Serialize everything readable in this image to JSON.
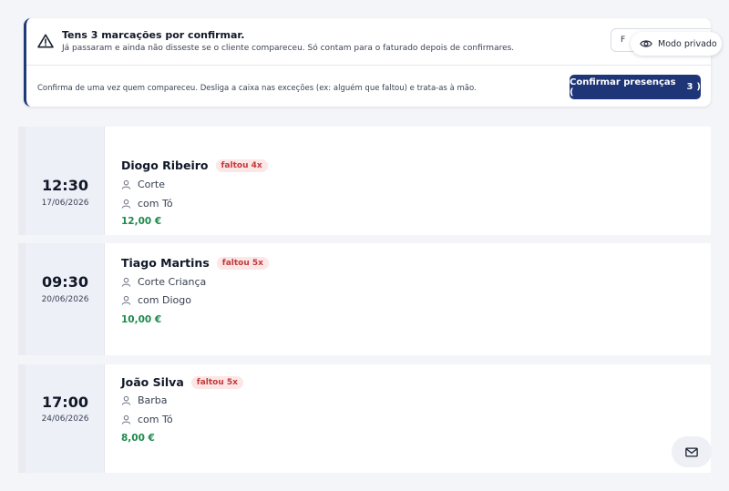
{
  "alert": {
    "title": "Tens 3 marcações por confirmar.",
    "description": "Já passaram e ainda não disseste se o cliente compareceu. Só contam para o faturado depois de confirmares.",
    "stub_label": "F",
    "hint": "Confirma de uma vez quem compareceu. Desliga a caixa nas exceções (ex: alguém que faltou) e trata-as à mão.",
    "confirm_label": "Confirmar presenças (",
    "confirm_count": "3",
    "confirm_close": ")",
    "icon": "warning-icon"
  },
  "private_mode": {
    "label": "Modo privado",
    "icon": "eye-icon"
  },
  "appointments": [
    {
      "time": "12:30",
      "date": "17/06/2026",
      "client": "Diogo Ribeiro",
      "badge": "faltou 4x",
      "service": "Corte",
      "staff": "com Tó",
      "price": "12,00 €"
    },
    {
      "time": "09:30",
      "date": "20/06/2026",
      "client": "Tiago Martins",
      "badge": "faltou 5x",
      "service": "Corte Criança",
      "staff": "com Diogo",
      "price": "10,00 €"
    },
    {
      "time": "17:00",
      "date": "24/06/2026",
      "client": "João Silva",
      "badge": "faltou 5x",
      "service": "Barba",
      "staff": "com Tó",
      "price": "8,00 €"
    }
  ],
  "message_button": {
    "icon": "mail-icon"
  },
  "colors": {
    "primary": "#1e3677",
    "price_green": "#1f8a4c",
    "badge_red": "#c03a3a",
    "badge_bg": "#fde6e6"
  }
}
